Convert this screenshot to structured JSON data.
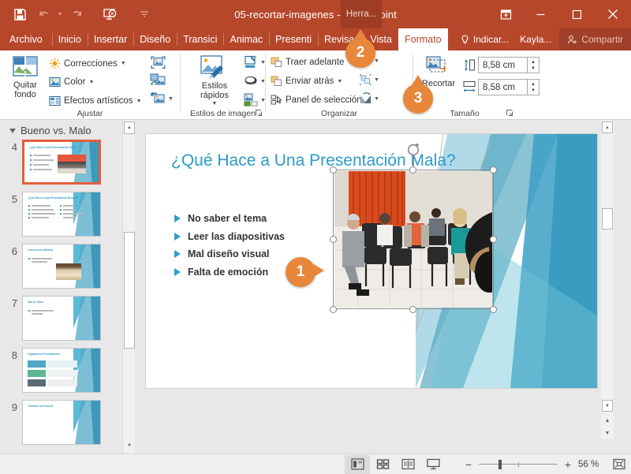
{
  "window": {
    "document_title": "05-recortar-imagenes - PowerPoint",
    "contextual_tab": "Herra...",
    "minimize": "–",
    "maximize": "☐",
    "close": "✕"
  },
  "quick_access": {
    "save": "save-icon",
    "undo": "undo-icon",
    "redo": "redo-icon",
    "slideshow": "start-slideshow-icon",
    "customize": "customize-qat-icon"
  },
  "tabs": [
    {
      "label": "Archivo",
      "active": false
    },
    {
      "label": "Inicio",
      "active": false
    },
    {
      "label": "Insertar",
      "active": false
    },
    {
      "label": "Diseño",
      "active": false
    },
    {
      "label": "Transici",
      "active": false
    },
    {
      "label": "Animac",
      "active": false
    },
    {
      "label": "Presenti",
      "active": false
    },
    {
      "label": "Revisar",
      "active": false
    },
    {
      "label": "Vista",
      "active": false
    },
    {
      "label": "Formato",
      "active": true
    }
  ],
  "tell_me": "Indicar...",
  "account": "Kayla...",
  "share": "Compartir",
  "ribbon": {
    "groups": [
      {
        "name": "Ajustar",
        "label": "Ajustar",
        "big_button": "Quitar fondo",
        "items": [
          "Correcciones",
          "Color",
          "Efectos artísticos"
        ],
        "icon_items": [
          "comprimir-imagen",
          "cambiar-imagen",
          "restablecer-imagen"
        ]
      },
      {
        "name": "Estilos de imagen",
        "label": "Estilos de imagen",
        "big_button": "Estilos rápidos",
        "icon_items": [
          "contorno-de-imagen",
          "efectos-de-imagen",
          "diseno-de-imagen"
        ]
      },
      {
        "name": "Organizar",
        "label": "Organizar",
        "items": [
          "Traer adelante",
          "Enviar atrás",
          "Panel de selección"
        ],
        "icon_items": [
          "alinear",
          "agrupar",
          "girar"
        ]
      },
      {
        "name": "Tamaño",
        "label": "Tamaño",
        "big_button": "Recortar",
        "height_value": "8,58 cm",
        "width_value": "8,58 cm"
      }
    ]
  },
  "thumbnails": {
    "section_title": "Bueno vs. Malo",
    "slides": [
      {
        "number": "4",
        "title": "¿Qué Hace a Una Presentación Mala?",
        "selected": true
      },
      {
        "number": "5",
        "title": "¿Qué Hace a Una Presentación Buena?",
        "selected": false
      },
      {
        "number": "6",
        "title": "Cuenta una Historia",
        "selected": false
      },
      {
        "number": "7",
        "title": "Haz tu Tarea",
        "selected": false
      },
      {
        "number": "8",
        "title": "Organiza tu Presentación",
        "selected": false
      },
      {
        "number": "9",
        "title": "Termina con Fuerza",
        "selected": false
      }
    ]
  },
  "slide": {
    "title": "¿Qué Hace a Una Presentación Mala?",
    "bullets": [
      "No saber el tema",
      "Leer las diapositivas",
      "Mal diseño visual",
      "Falta de emoción"
    ],
    "image_alt": "audiencia-aburrida-foto"
  },
  "status_bar": {
    "views": [
      "vista-normal",
      "clasificador-de-diapositivas",
      "vista-de-lectura",
      "presentacion-con-diapositivas"
    ],
    "zoom_out": "−",
    "zoom_in": "+",
    "zoom_level": "56 %",
    "fit_to_window": "ajustar-a-ventana"
  },
  "callouts": [
    {
      "number": "1",
      "direction": "right"
    },
    {
      "number": "2",
      "direction": "up"
    },
    {
      "number": "3",
      "direction": "up"
    }
  ],
  "colors": {
    "brand_orange": "#b7472a",
    "callout_orange": "#e8873a",
    "slide_accent_blue": "#2e9bc9",
    "selection_border": "#e2603a"
  }
}
